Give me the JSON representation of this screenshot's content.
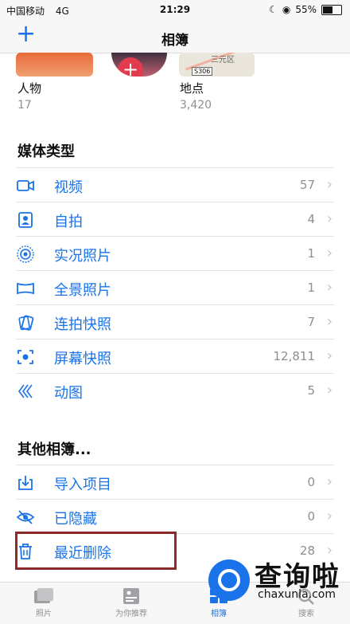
{
  "status_bar": {
    "carrier": "中国移动",
    "network": "4G",
    "time": "21:29",
    "battery": "55%",
    "battery_level": 0.55
  },
  "nav": {
    "add_label": "+",
    "title": "相簿"
  },
  "top_albums": [
    {
      "label": "人物",
      "count": "17"
    },
    {
      "label": "地点",
      "count": "3,420"
    }
  ],
  "map_thumb": {
    "area_label": "三元区",
    "road_shield": "S306"
  },
  "media_types": {
    "title": "媒体类型",
    "items": [
      {
        "label": "视频",
        "count": "57",
        "icon": "video-icon"
      },
      {
        "label": "自拍",
        "count": "4",
        "icon": "selfie-icon"
      },
      {
        "label": "实况照片",
        "count": "1",
        "icon": "live-photo-icon"
      },
      {
        "label": "全景照片",
        "count": "1",
        "icon": "panorama-icon"
      },
      {
        "label": "连拍快照",
        "count": "7",
        "icon": "burst-icon"
      },
      {
        "label": "屏幕快照",
        "count": "12,811",
        "icon": "screenshot-icon"
      },
      {
        "label": "动图",
        "count": "5",
        "icon": "animated-icon"
      }
    ]
  },
  "other_albums": {
    "title": "其他相簿...",
    "items": [
      {
        "label": "导入项目",
        "count": "0",
        "icon": "import-icon"
      },
      {
        "label": "已隐藏",
        "count": "0",
        "icon": "hidden-icon"
      },
      {
        "label": "最近删除",
        "count": "28",
        "icon": "trash-icon"
      }
    ]
  },
  "tab_bar": [
    {
      "label": "照片",
      "icon": "photos-tab-icon",
      "active": false
    },
    {
      "label": "为你推荐",
      "icon": "for-you-tab-icon",
      "active": false
    },
    {
      "label": "相簿",
      "icon": "albums-tab-icon",
      "active": true
    },
    {
      "label": "搜索",
      "icon": "search-tab-icon",
      "active": false
    }
  ],
  "watermark": {
    "title": "查询啦",
    "subtitle": "chaxunla.com"
  },
  "colors": {
    "accent": "#1a73e8",
    "highlight_border": "#8b2a2a"
  }
}
